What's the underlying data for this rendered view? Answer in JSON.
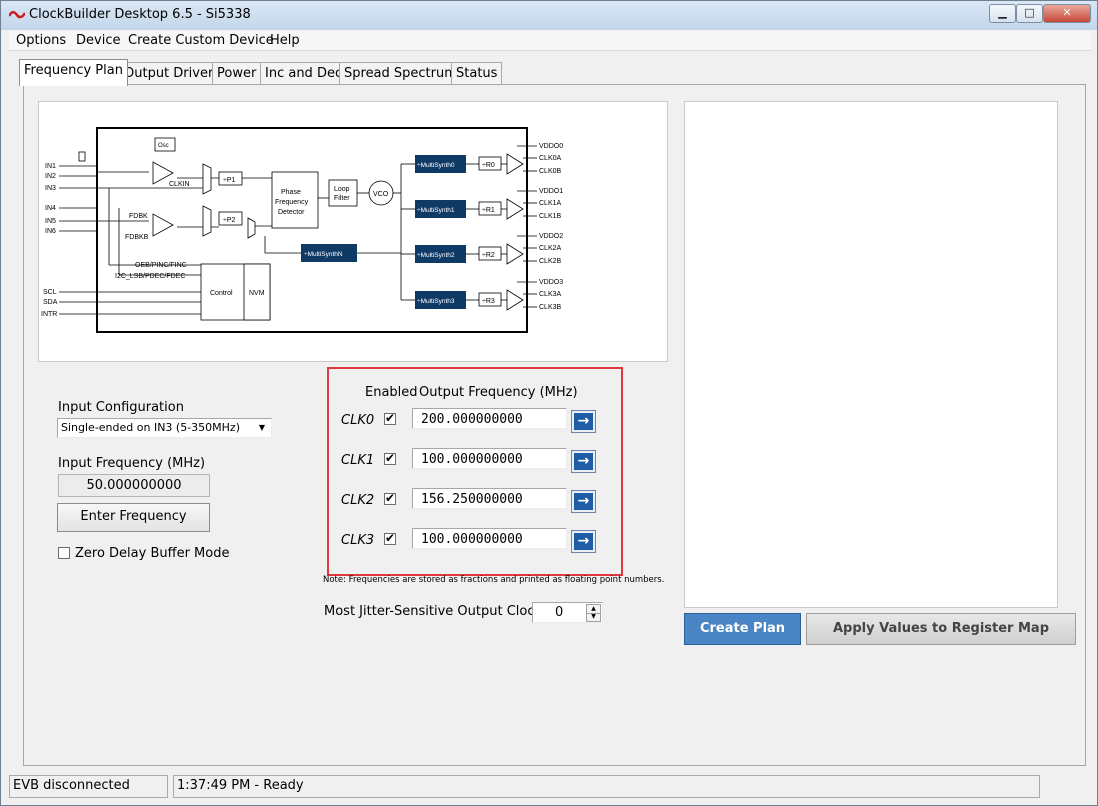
{
  "app": {
    "title": "ClockBuilder Desktop 6.5 - Si5338"
  },
  "window_controls": {
    "minimize": "▁",
    "maximize": "□",
    "close": "✕"
  },
  "menu": [
    "Options",
    "Device",
    "Create Custom Device",
    "Help"
  ],
  "tabs": [
    "Frequency Plan",
    "Output Drivers",
    "Power",
    "Inc and Dec",
    "Spread Spectrum",
    "Status"
  ],
  "diagram": {
    "inputs": [
      "IN1",
      "IN2",
      "IN3",
      "IN4",
      "IN5",
      "IN6"
    ],
    "osc": "Osc",
    "clkin": "CLKIN",
    "fdbk": "FDBK",
    "fdbkb": "FDBKB",
    "p1": "÷P1",
    "p2": "÷P2",
    "pfd": [
      "Phase",
      "Frequency",
      "Detector"
    ],
    "loop_filter": [
      "Loop",
      "Filter"
    ],
    "vco": "VCO",
    "multisynth_n": "÷MultiSynthN",
    "oeb": "OEB/PINC/FINC",
    "i2c": "I2C_LSB/PDEC/FDEC",
    "control": "Control",
    "nvm": "NVM",
    "scl": "SCL",
    "sda": "SDA",
    "intr": "INTR",
    "multisynths": [
      "÷MultiSynth0",
      "÷MultiSynth1",
      "÷MultiSynth2",
      "÷MultiSynth3"
    ],
    "r_dividers": [
      "÷R0",
      "÷R1",
      "÷R2",
      "÷R3"
    ],
    "vddo": [
      "VDDO0",
      "VDDO1",
      "VDDO2",
      "VDDO3"
    ],
    "clka": [
      "CLK0A",
      "CLK1A",
      "CLK2A",
      "CLK3A"
    ],
    "clkb": [
      "CLK0B",
      "CLK1B",
      "CLK2B",
      "CLK3B"
    ]
  },
  "input_config": {
    "label": "Input Configuration",
    "selected": "Single-ended on IN3 (5-350MHz)",
    "dropdown_icon": "chevron-down"
  },
  "input_frequency": {
    "label": "Input Frequency (MHz)",
    "value": "50.000000000",
    "button": "Enter Frequency"
  },
  "zero_delay": {
    "label": "Zero Delay Buffer Mode",
    "checked": false
  },
  "outputs": {
    "enabled_header": "Enabled",
    "freq_header": "Output Frequency (MHz)",
    "rows": [
      {
        "name": "CLK0",
        "enabled": true,
        "freq": "200.000000000"
      },
      {
        "name": "CLK1",
        "enabled": true,
        "freq": "100.000000000"
      },
      {
        "name": "CLK2",
        "enabled": true,
        "freq": "156.250000000"
      },
      {
        "name": "CLK3",
        "enabled": true,
        "freq": "100.000000000"
      }
    ],
    "highlight_color": "#e0383e"
  },
  "note": "Note: Frequencies are stored as fractions and printed as floating point numbers.",
  "jitter": {
    "label": "Most Jitter-Sensitive Output Clock:",
    "value": "0"
  },
  "buttons": {
    "create_plan": "Create Plan",
    "apply": "Apply Values to Register Map"
  },
  "status": {
    "evb": "EVB disconnected",
    "message": "1:37:49 PM - Ready"
  },
  "colors": {
    "accent_blue": "#4a86c5",
    "diagram_navy": "#0f3a66",
    "arrow_blue": "#1f5ea6"
  }
}
